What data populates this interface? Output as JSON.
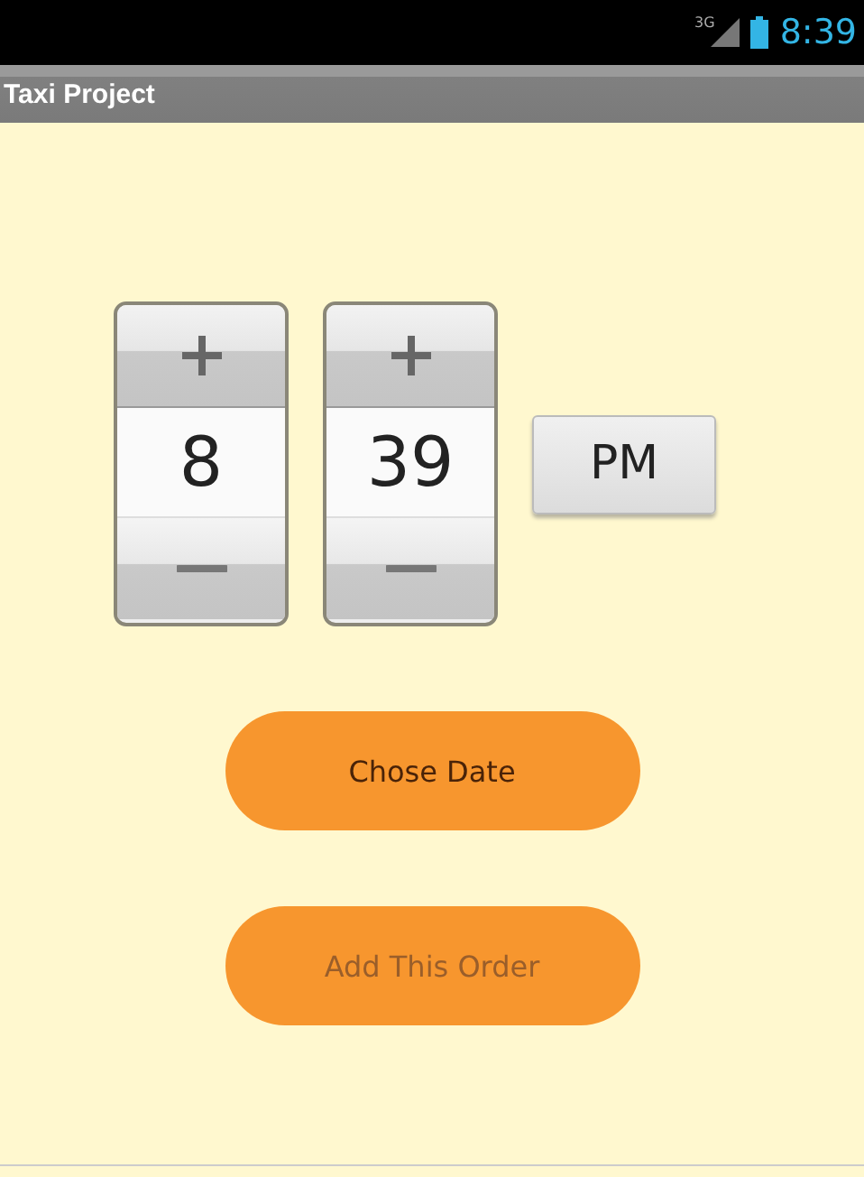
{
  "status_bar": {
    "network": "3G",
    "time": "8:39"
  },
  "action_bar": {
    "title": "Taxi Project"
  },
  "time_picker": {
    "hour": "8",
    "minute": "39",
    "am_pm": "PM"
  },
  "buttons": [
    {
      "label": "Chose Date",
      "disabled": false
    },
    {
      "label": "Add This Order",
      "disabled": true
    }
  ]
}
